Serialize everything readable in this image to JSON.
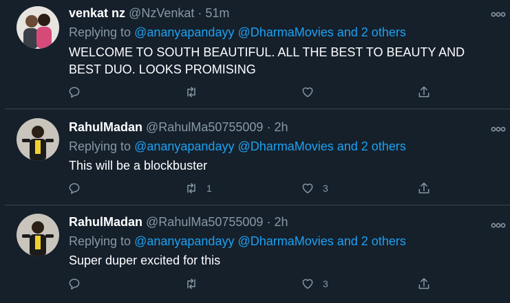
{
  "tweets": [
    {
      "name": "venkat nz",
      "handle": "@NzVenkat",
      "separator": "·",
      "time": "51m",
      "replying_prefix": "Replying to",
      "replying_mentions": "@ananyapandayy @DharmaMovies and 2 others",
      "text": "WELCOME TO SOUTH BEAUTIFUL.  ALL THE BEST TO BEAUTY AND BEST DUO.  LOOKS PROMISING",
      "retweet_count": "",
      "like_count": ""
    },
    {
      "name": "RahulMadan",
      "handle": "@RahulMa50755009",
      "separator": "·",
      "time": "2h",
      "replying_prefix": "Replying to",
      "replying_mentions": "@ananyapandayy @DharmaMovies and 2 others",
      "text": "This will be a blockbuster",
      "retweet_count": "1",
      "like_count": "3"
    },
    {
      "name": "RahulMadan",
      "handle": "@RahulMa50755009",
      "separator": "·",
      "time": "2h",
      "replying_prefix": "Replying to",
      "replying_mentions": "@ananyapandayy @DharmaMovies and 2 others",
      "text": "Super duper excited for this",
      "retweet_count": "",
      "like_count": "3"
    }
  ],
  "icons": {
    "reply": "reply-icon",
    "retweet": "retweet-icon",
    "like": "heart-icon",
    "share": "share-icon",
    "more": "more-icon"
  },
  "colors": {
    "background": "#15202b",
    "divider": "#38444d",
    "name": "#ffffff",
    "muted": "#8899a6",
    "link": "#1da1f2",
    "text": "#ffffff"
  }
}
